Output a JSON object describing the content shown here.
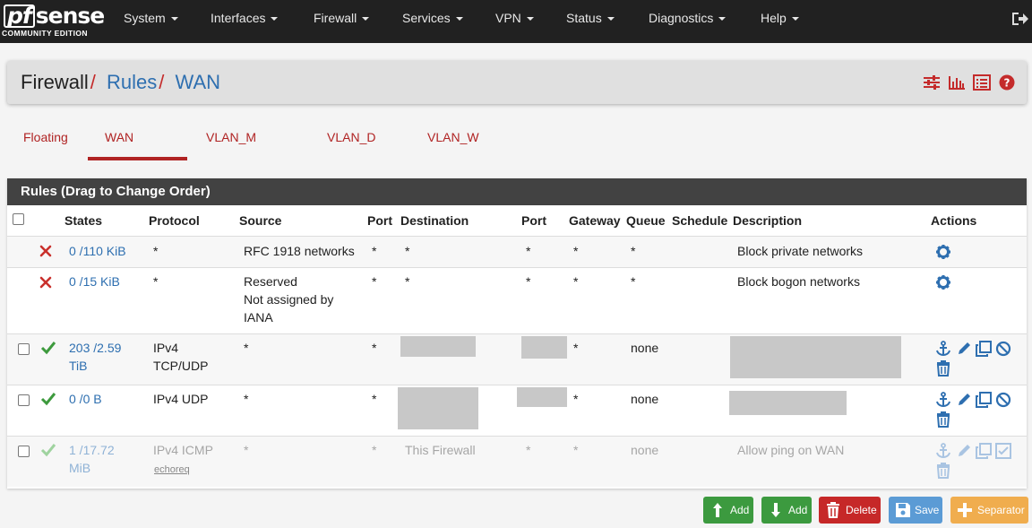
{
  "app": {
    "logo_brand": "pfsense",
    "logo_pf": "pf",
    "logo_rest": "sense",
    "logo_edition": "COMMUNITY EDITION"
  },
  "nav": {
    "items": [
      {
        "label": "System"
      },
      {
        "label": "Interfaces"
      },
      {
        "label": "Firewall"
      },
      {
        "label": "Services"
      },
      {
        "label": "VPN"
      },
      {
        "label": "Status"
      },
      {
        "label": "Diagnostics"
      },
      {
        "label": "Help"
      }
    ],
    "logout_icon": "sign-out-icon"
  },
  "breadcrumb": {
    "parts": [
      "Firewall",
      "Rules",
      "WAN"
    ],
    "separator": "/",
    "icons": [
      "sliders-icon",
      "bar-chart-icon",
      "list-icon",
      "help-icon"
    ]
  },
  "tabs": [
    {
      "label": "Floating",
      "active": false
    },
    {
      "label": "WAN",
      "active": true
    },
    {
      "label": "VLAN_M",
      "active": false
    },
    {
      "label": "VLAN_D",
      "active": false
    },
    {
      "label": "VLAN_W",
      "active": false
    }
  ],
  "rules": {
    "title": "Rules (Drag to Change Order)",
    "columns": [
      "States",
      "Protocol",
      "Source",
      "Port",
      "Destination",
      "Port",
      "Gateway",
      "Queue",
      "Schedule",
      "Description",
      "Actions"
    ],
    "rows": [
      {
        "status": "block",
        "states_line1": "0 /110 KiB",
        "states_line2": "",
        "protocol_line1": "*",
        "protocol_line2": "",
        "protocol_sub": "",
        "source_line1": "RFC 1918 networks",
        "source_line2": "",
        "source_line3": "",
        "src_port": "*",
        "destination": "*",
        "dst_port": "*",
        "gateway": "*",
        "queue": "*",
        "schedule": "",
        "description": "Block private networks",
        "disabled": false
      },
      {
        "status": "block",
        "states_line1": "0 /15 KiB",
        "states_line2": "",
        "protocol_line1": "*",
        "protocol_line2": "",
        "protocol_sub": "",
        "source_line1": "Reserved",
        "source_line2": "Not assigned by",
        "source_line3": "IANA",
        "src_port": "*",
        "destination": "*",
        "dst_port": "*",
        "gateway": "*",
        "queue": "*",
        "schedule": "",
        "description": "Block bogon networks",
        "disabled": false
      },
      {
        "status": "pass",
        "states_line1": "203 /2.59",
        "states_line2": "TiB",
        "protocol_line1": "IPv4",
        "protocol_line2": "TCP/UDP",
        "protocol_sub": "",
        "source_line1": "*",
        "source_line2": "",
        "source_line3": "",
        "src_port": "*",
        "destination": "",
        "dst_port": "",
        "gateway": "*",
        "queue": "none",
        "schedule": "",
        "description": "",
        "disabled": false
      },
      {
        "status": "pass",
        "states_line1": "0 /0 B",
        "states_line2": "",
        "protocol_line1": "IPv4 UDP",
        "protocol_line2": "",
        "protocol_sub": "",
        "source_line1": "*",
        "source_line2": "",
        "source_line3": "",
        "src_port": "*",
        "destination": "",
        "dst_port": "",
        "gateway": "*",
        "queue": "none",
        "schedule": "",
        "description": "",
        "disabled": false
      },
      {
        "status": "pass",
        "states_line1": "1 /17.72",
        "states_line2": "MiB",
        "protocol_line1": "IPv4 ICMP",
        "protocol_line2": "",
        "protocol_sub": "echoreq",
        "source_line1": "*",
        "source_line2": "",
        "source_line3": "",
        "src_port": "*",
        "destination": "This Firewall",
        "dst_port": "*",
        "gateway": "*",
        "queue": "none",
        "schedule": "",
        "description": "Allow ping on WAN",
        "disabled": true
      }
    ]
  },
  "buttons": [
    {
      "label": "Add",
      "icon": "arrow-up-icon",
      "color": "#3c9a3f"
    },
    {
      "label": "Add",
      "icon": "arrow-down-icon",
      "color": "#3c9a3f"
    },
    {
      "label": "Delete",
      "icon": "trash-icon",
      "color": "#c62828"
    },
    {
      "label": "Save",
      "icon": "save-icon",
      "color": "#5b9bd5"
    },
    {
      "label": "Separator",
      "icon": "plus-icon",
      "color": "#f0ad4e"
    }
  ],
  "colors": {
    "navbar": "#212121",
    "link": "#2e6fb0",
    "accent_red": "#b02323",
    "panel_head": "#424242",
    "pass_green": "#3d9a3d",
    "block_red": "#c9302c",
    "action_blue": "#2e6fb0"
  }
}
